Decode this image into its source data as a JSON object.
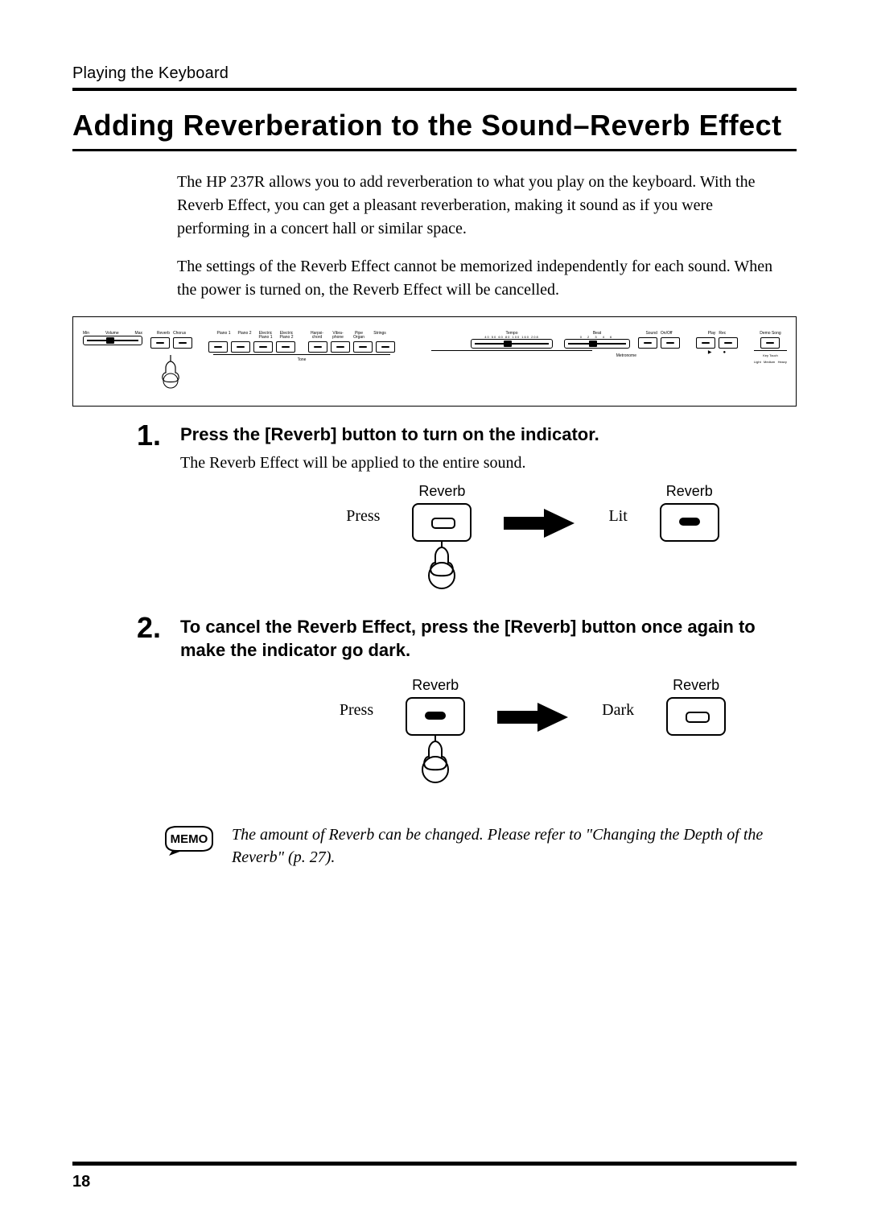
{
  "running_head": "Playing the Keyboard",
  "title": "Adding Reverberation to the Sound–Reverb Effect",
  "intro": {
    "p1": "The HP 237R allows you to add reverberation to what you play on the keyboard. With the Reverb Effect, you can get a pleasant reverberation, making it sound as if you were performing in a concert hall or similar space.",
    "p2": "The settings of the Reverb Effect cannot be memorized independently for each sound. When the power is turned on, the Reverb Effect will be cancelled."
  },
  "panel": {
    "volume": {
      "label": "Volume",
      "min": "Min",
      "max": "Max"
    },
    "effects": [
      "Reverb",
      "Chorus"
    ],
    "tones": [
      "Piano 1",
      "Piano 2",
      "Electric Piano 1",
      "Electric Piano 2",
      "Harpsi-chord",
      "Vibra-phone",
      "Pipe Organ",
      "Strings"
    ],
    "tone_group": "Tone",
    "tempo": {
      "label": "Tempo",
      "ticks": "40 50 60 80 100 160 208"
    },
    "beat": {
      "label": "Beat",
      "ticks": "0   2   3   4   6"
    },
    "metronome_group": "Metronome",
    "sound": "Sound",
    "onoff": "On/Off",
    "play": "Play",
    "rec": "Rec",
    "demo": "Demo Song",
    "keytouch": "Key Touch",
    "touch_levels": "Light   Medium   Heavy",
    "play_marker": "▶",
    "rec_marker": "●"
  },
  "steps": {
    "s1": {
      "num": "1.",
      "heading": "Press the [Reverb] button to turn on the indicator.",
      "text": "The Reverb Effect will be applied to the entire sound.",
      "left_label": "Press",
      "caption_l": "Reverb",
      "right_label": "Lit",
      "caption_r": "Reverb"
    },
    "s2": {
      "num": "2.",
      "heading": "To cancel the Reverb Effect, press the [Reverb] button once again to make the indicator go dark.",
      "left_label": "Press",
      "caption_l": "Reverb",
      "right_label": "Dark",
      "caption_r": "Reverb"
    }
  },
  "memo": {
    "label": "MEMO",
    "text": "The amount of Reverb can be changed. Please refer to \"Changing the Depth of the Reverb\" (p. 27)."
  },
  "page_number": "18"
}
